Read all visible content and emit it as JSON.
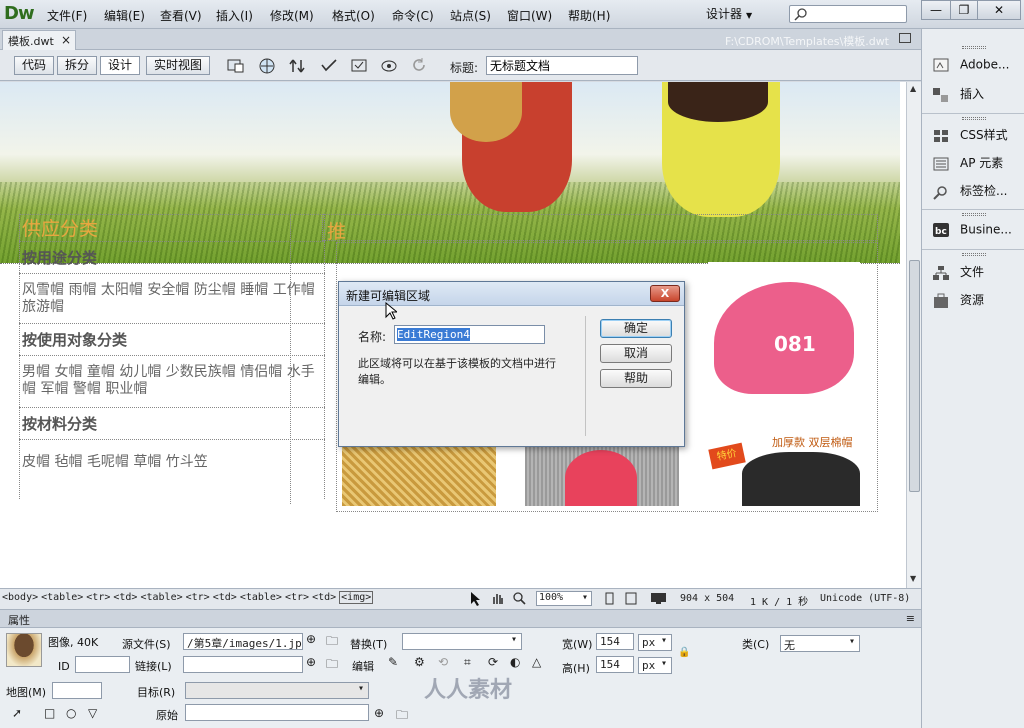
{
  "app": {
    "logo": "Dw",
    "menu": [
      "文件(F)",
      "编辑(E)",
      "查看(V)",
      "插入(I)",
      "修改(M)",
      "格式(O)",
      "命令(C)",
      "站点(S)",
      "窗口(W)",
      "帮助(H)"
    ],
    "workspace": "设计器",
    "window_controls": [
      "—",
      "❐",
      "✕"
    ]
  },
  "document": {
    "tab_name": "模板.dwt",
    "tab_close": "×",
    "path": "F:\\CDROM\\Templates\\模板.dwt"
  },
  "toolbar": {
    "views": [
      "代码",
      "拆分",
      "设计",
      "实时视图"
    ],
    "active_view": "设计",
    "title_label": "标题:",
    "title_value": "无标题文档"
  },
  "page": {
    "left_heading": "供应分类",
    "right_heading": "推",
    "categories": [
      {
        "title": "按用途分类",
        "items": "风雪帽 雨帽 太阳帽 安全帽 防尘帽 睡帽 工作帽 旅游帽"
      },
      {
        "title": "按使用对象分类",
        "items": "男帽 女帽 童帽 幼儿帽 少数民族帽 情侣帽 水手帽 军帽 警帽 职业帽"
      },
      {
        "title": "按材料分类",
        "items": "皮帽 毡帽 毛呢帽 草帽 竹斗笠"
      }
    ],
    "cap_text": "081",
    "promo_badge": "特价",
    "promo_text": "加厚款 双层棉帽"
  },
  "statusbar": {
    "tags": [
      "<body>",
      "<table>",
      "<tr>",
      "<td>",
      "<table>",
      "<tr>",
      "<td>",
      "<table>",
      "<tr>",
      "<td>",
      "<img>"
    ],
    "selected_tag": "<img>",
    "zoom": "100%",
    "dimensions": "904 x 504",
    "size": "1 K / 1 秒",
    "encoding": "Unicode (UTF-8)"
  },
  "properties": {
    "header": "属性",
    "image_label": "图像, 40K",
    "src_label": "源文件(S)",
    "src_value": "/第5章/images/1.jpg",
    "alt_label": "替换(T)",
    "width_label": "宽(W)",
    "width_value": "154",
    "width_unit": "px",
    "height_label": "高(H)",
    "height_value": "154",
    "height_unit": "px",
    "class_label": "类(C)",
    "class_value": "无",
    "id_label": "ID",
    "link_label": "链接(L)",
    "edit_label": "编辑",
    "map_label": "地图(M)",
    "target_label": "目标(R)",
    "original_label": "原始",
    "watermark": "人人素材"
  },
  "panels": {
    "items": [
      {
        "label": "Adobe...",
        "icon": "adobe-browserlab-icon"
      },
      {
        "label": "插入",
        "icon": "insert-icon"
      },
      {
        "label": "CSS样式",
        "icon": "css-styles-icon"
      },
      {
        "label": "AP 元素",
        "icon": "ap-elements-icon"
      },
      {
        "label": "标签检...",
        "icon": "tag-inspector-icon"
      },
      {
        "label": "Busine...",
        "icon": "business-catalyst-icon"
      },
      {
        "label": "文件",
        "icon": "files-icon"
      },
      {
        "label": "资源",
        "icon": "assets-icon"
      }
    ]
  },
  "dialog": {
    "title": "新建可编辑区域",
    "close": "X",
    "name_label": "名称:",
    "name_value": "EditRegion4",
    "description": "此区域将可以在基于该模板的文档中进行编辑。",
    "buttons": [
      "确定",
      "取消",
      "帮助"
    ]
  },
  "colors": {
    "heading_orange": "#e8a640",
    "selection_blue": "#3a7bd5",
    "dw_green": "#2f6d1e"
  }
}
